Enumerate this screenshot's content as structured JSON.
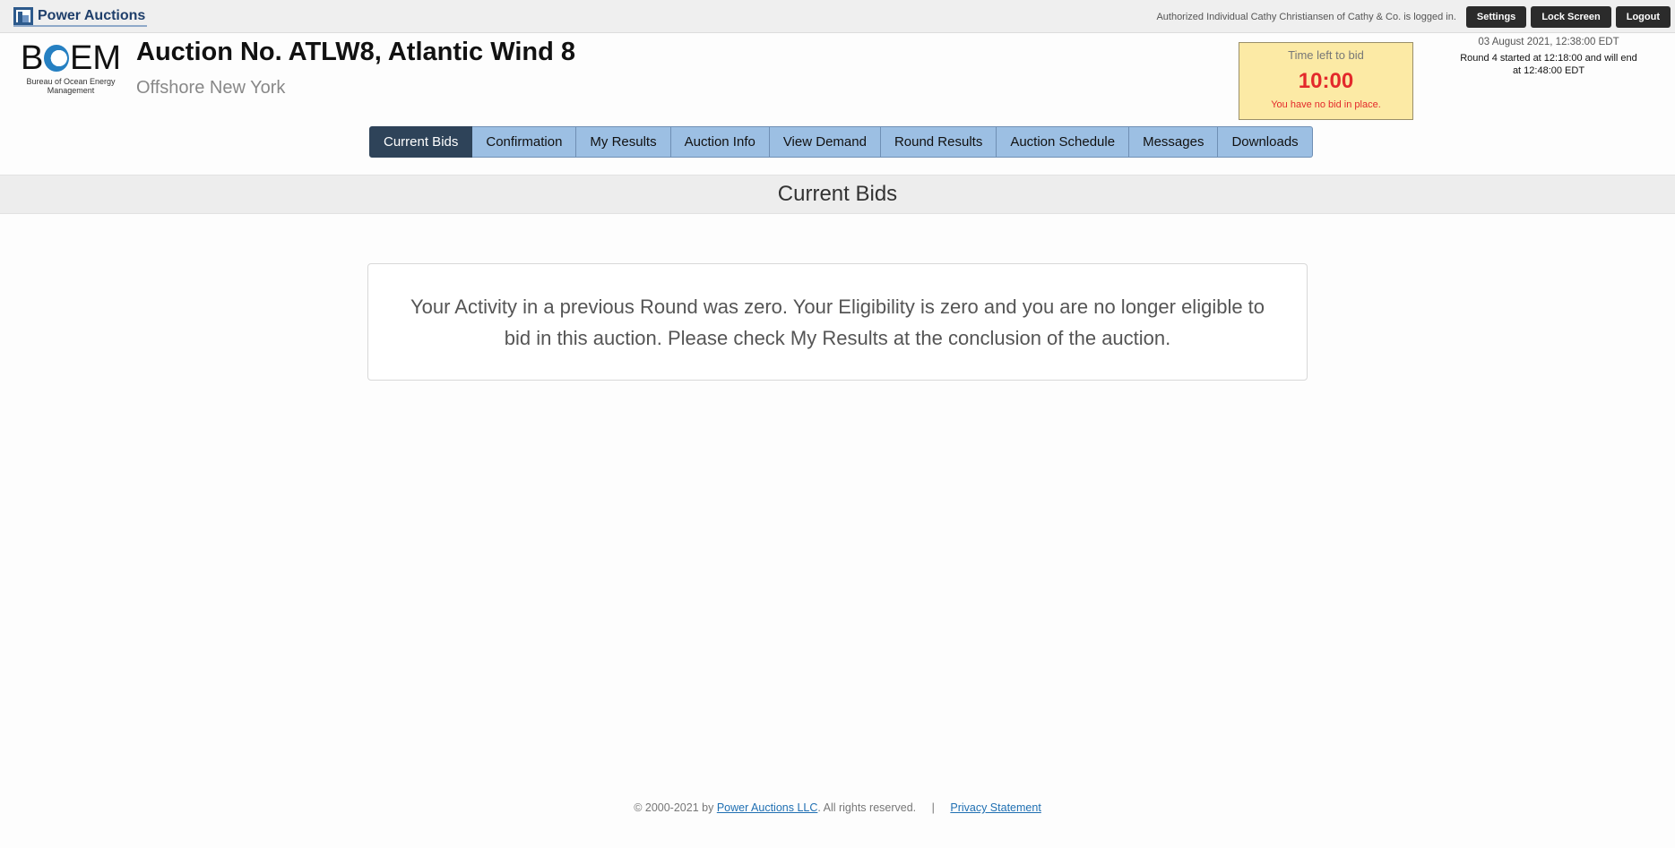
{
  "topbar": {
    "brand": "Power Auctions",
    "logged_in_text": "Authorized Individual Cathy Christiansen of Cathy & Co. is logged in.",
    "buttons": {
      "settings": "Settings",
      "lock_screen": "Lock Screen",
      "logout": "Logout"
    }
  },
  "logo": {
    "word_left": "B",
    "word_right": "EM",
    "subtitle": "Bureau of Ocean Energy Management"
  },
  "header": {
    "title": "Auction No. ATLW8, Atlantic Wind 8",
    "subtitle": "Offshore New York"
  },
  "timer": {
    "label": "Time left to bid",
    "value": "10:00",
    "note": "You have no bid in place."
  },
  "round": {
    "date": "03 August 2021, 12:38:00 EDT",
    "line1": "Round 4 started at 12:18:00 and will end",
    "line2": "at 12:48:00 EDT"
  },
  "tabs": [
    {
      "label": "Current Bids",
      "active": true
    },
    {
      "label": "Confirmation"
    },
    {
      "label": "My Results"
    },
    {
      "label": "Auction Info"
    },
    {
      "label": "View Demand"
    },
    {
      "label": "Round Results"
    },
    {
      "label": "Auction Schedule"
    },
    {
      "label": "Messages"
    },
    {
      "label": "Downloads"
    }
  ],
  "section": {
    "title": "Current Bids"
  },
  "message": {
    "line1": "Your Activity in a previous Round was zero. Your Eligibility is zero and you are no longer eligible to",
    "line2": "bid in this auction. Please check My Results at the conclusion of the auction."
  },
  "footer": {
    "copyright": "© 2000-2021 by",
    "company_link": "Power Auctions LLC",
    "rights": ". All rights reserved.",
    "separator": "|",
    "privacy_link": "Privacy Statement"
  },
  "colors": {
    "active_tab": "#2e4359",
    "tab": "#9cbfe3",
    "timer_bg": "#fceaa5",
    "timer_text": "#e3292b"
  }
}
